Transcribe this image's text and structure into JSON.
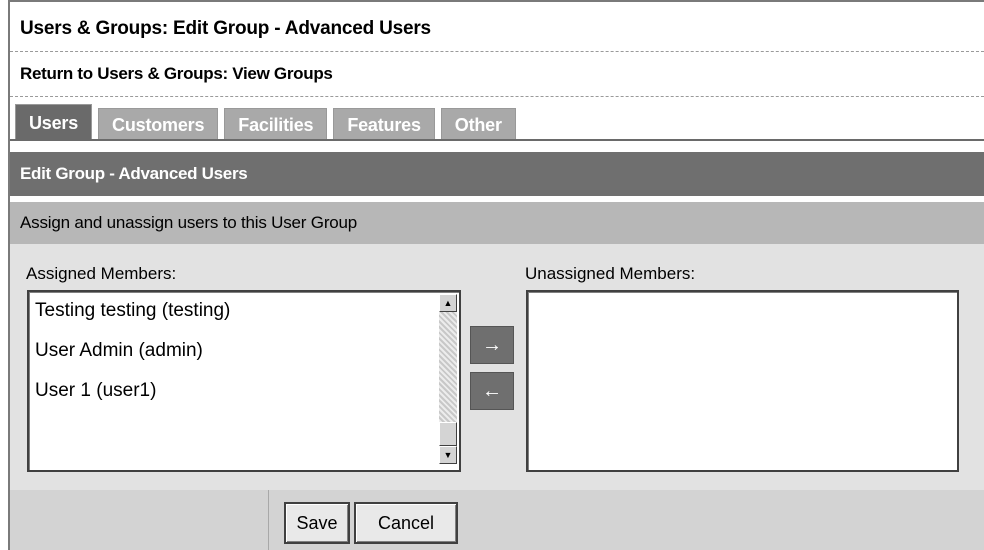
{
  "page": {
    "title": "Users & Groups: Edit Group - Advanced Users",
    "return_link": "Return to Users & Groups: View Groups"
  },
  "tabs": [
    {
      "label": "Users",
      "active": true
    },
    {
      "label": "Customers",
      "active": false
    },
    {
      "label": "Facilities",
      "active": false
    },
    {
      "label": "Features",
      "active": false
    },
    {
      "label": "Other",
      "active": false
    }
  ],
  "section": {
    "heading": "Edit Group - Advanced Users",
    "instructions": "Assign and unassign users to this User Group"
  },
  "assigned": {
    "label": "Assigned Members:",
    "members": [
      "Testing testing (testing)",
      "User Admin (admin)",
      "User 1 (user1)"
    ]
  },
  "unassigned": {
    "label": "Unassigned Members:",
    "members": []
  },
  "transfer": {
    "move_right_icon": "arrow-right-icon",
    "move_left_icon": "arrow-left-icon",
    "move_right_glyph": "→",
    "move_left_glyph": "←"
  },
  "actions": {
    "save_label": "Save",
    "cancel_label": "Cancel"
  },
  "colors": {
    "tab_active": "#6a6a6a",
    "tab_inactive": "#a9a9a9",
    "section_header": "#6f6f6f",
    "instruction_bar": "#b7b7b7"
  }
}
